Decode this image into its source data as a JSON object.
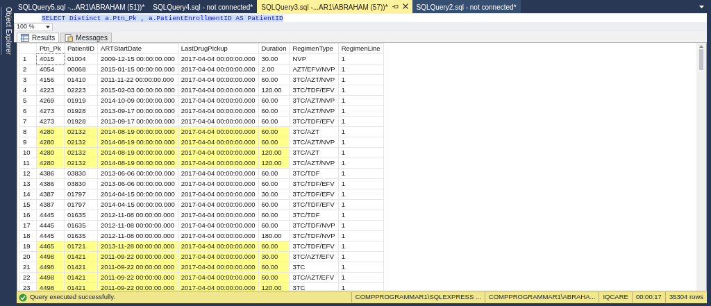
{
  "side_panel": {
    "title": "Object Explorer"
  },
  "doc_tabs": [
    {
      "label": "SQLQuery5.sql -...AR1\\ABRAHAM (51))*",
      "selected": false
    },
    {
      "label": "SQLQuery4.sql - not connected*",
      "selected": false
    },
    {
      "label": "SQLQuery3.sql -...AR1\\ABRAHAM (57))*",
      "selected": true
    },
    {
      "label": "SQLQuery2.sql - not connected*",
      "selected": false
    }
  ],
  "editor": {
    "code": "SELECT Distinct a.Ptn_Pk , a.PatientEnrollmentID AS PatientID"
  },
  "zoom": {
    "value": "100 %"
  },
  "result_tabs": [
    {
      "label": "Results",
      "selected": true
    },
    {
      "label": "Messages",
      "selected": false
    }
  ],
  "table": {
    "columns": [
      "Ptn_Pk",
      "PatientID",
      "ARTStartDate",
      "LastDrugPickup",
      "Duration",
      "RegimenType",
      "RegimenLine"
    ],
    "rows": [
      {
        "num": "1",
        "cells": [
          "4015",
          "01004",
          "2009-12-15 00:00:00.000",
          "2017-04-04 00:00:00.000",
          "30.00",
          "NVP",
          "1"
        ],
        "highlighted": false
      },
      {
        "num": "2",
        "cells": [
          "4054",
          "00068",
          "2015-01-15 00:00:00.000",
          "2017-04-04 00:00:00.000",
          "2.00",
          "AZT/EFV/NVP",
          "1"
        ],
        "highlighted": false
      },
      {
        "num": "3",
        "cells": [
          "4156",
          "01410",
          "2011-11-22 00:00:00.000",
          "2017-04-04 00:00:00.000",
          "60.00",
          "3TC/AZT/NVP",
          "1"
        ],
        "highlighted": false
      },
      {
        "num": "4",
        "cells": [
          "4223",
          "02223",
          "2015-02-03 00:00:00.000",
          "2017-04-04 00:00:00.000",
          "120.00",
          "3TC/TDF/EFV",
          "1"
        ],
        "highlighted": false
      },
      {
        "num": "5",
        "cells": [
          "4269",
          "01919",
          "2014-10-09 00:00:00.000",
          "2017-04-04 00:00:00.000",
          "60.00",
          "3TC/AZT/NVP",
          "1"
        ],
        "highlighted": false
      },
      {
        "num": "6",
        "cells": [
          "4273",
          "01928",
          "2013-09-17 00:00:00.000",
          "2017-04-04 00:00:00.000",
          "60.00",
          "3TC/AZT/NVP",
          "1"
        ],
        "highlighted": false
      },
      {
        "num": "7",
        "cells": [
          "4273",
          "01928",
          "2013-09-17 00:00:00.000",
          "2017-04-04 00:00:00.000",
          "60.00",
          "3TC/TDF/EFV",
          "1"
        ],
        "highlighted": false
      },
      {
        "num": "8",
        "cells": [
          "4280",
          "02132",
          "2014-08-19 00:00:00.000",
          "2017-04-04 00:00:00.000",
          "60.00",
          "3TC/AZT",
          "1"
        ],
        "highlighted": true
      },
      {
        "num": "9",
        "cells": [
          "4280",
          "02132",
          "2014-08-19 00:00:00.000",
          "2017-04-04 00:00:00.000",
          "60.00",
          "3TC/AZT/NVP",
          "1"
        ],
        "highlighted": true
      },
      {
        "num": "10",
        "cells": [
          "4280",
          "02132",
          "2014-08-19 00:00:00.000",
          "2017-04-04 00:00:00.000",
          "120.00",
          "3TC/AZT",
          "1"
        ],
        "highlighted": true
      },
      {
        "num": "11",
        "cells": [
          "4280",
          "02132",
          "2014-08-19 00:00:00.000",
          "2017-04-04 00:00:00.000",
          "120.00",
          "3TC/AZT/NVP",
          "1"
        ],
        "highlighted": true
      },
      {
        "num": "12",
        "cells": [
          "4386",
          "03830",
          "2013-06-06 00:00:00.000",
          "2017-04-04 00:00:00.000",
          "60.00",
          "3TC/TDF",
          "1"
        ],
        "highlighted": false
      },
      {
        "num": "13",
        "cells": [
          "4386",
          "03830",
          "2013-06-06 00:00:00.000",
          "2017-04-04 00:00:00.000",
          "60.00",
          "3TC/TDF/EFV",
          "1"
        ],
        "highlighted": false
      },
      {
        "num": "14",
        "cells": [
          "4387",
          "01797",
          "2014-04-15 00:00:00.000",
          "2017-04-04 00:00:00.000",
          "30.00",
          "3TC/TDF/EFV",
          "1"
        ],
        "highlighted": false
      },
      {
        "num": "15",
        "cells": [
          "4387",
          "01797",
          "2014-04-15 00:00:00.000",
          "2017-04-04 00:00:00.000",
          "60.00",
          "3TC/TDF/EFV",
          "1"
        ],
        "highlighted": false
      },
      {
        "num": "16",
        "cells": [
          "4445",
          "01635",
          "2012-11-08 00:00:00.000",
          "2017-04-04 00:00:00.000",
          "60.00",
          "3TC/TDF",
          "1"
        ],
        "highlighted": false
      },
      {
        "num": "17",
        "cells": [
          "4445",
          "01635",
          "2012-11-08 00:00:00.000",
          "2017-04-04 00:00:00.000",
          "60.00",
          "3TC/TDF/NVP",
          "1"
        ],
        "highlighted": false
      },
      {
        "num": "18",
        "cells": [
          "4445",
          "01635",
          "2012-11-08 00:00:00.000",
          "2017-04-04 00:00:00.000",
          "180.00",
          "3TC/TDF/NVP",
          "1"
        ],
        "highlighted": false
      },
      {
        "num": "19",
        "cells": [
          "4465",
          "01721",
          "2013-11-28 00:00:00.000",
          "2017-04-04 00:00:00.000",
          "60.00",
          "3TC/TDF/EFV",
          "1"
        ],
        "highlighted": true
      },
      {
        "num": "20",
        "cells": [
          "4498",
          "01421",
          "2011-09-22 00:00:00.000",
          "2017-04-04 00:00:00.000",
          "30.00",
          "3TC/AZT/EFV",
          "1"
        ],
        "highlighted": true
      },
      {
        "num": "21",
        "cells": [
          "4498",
          "01421",
          "2011-09-22 00:00:00.000",
          "2017-04-04 00:00:00.000",
          "60.00",
          "3TC",
          "1"
        ],
        "highlighted": true
      },
      {
        "num": "22",
        "cells": [
          "4498",
          "01421",
          "2011-09-22 00:00:00.000",
          "2017-04-04 00:00:00.000",
          "60.00",
          "3TC/AZT/EFV",
          "1"
        ],
        "highlighted": true
      },
      {
        "num": "23",
        "cells": [
          "4498",
          "01421",
          "2011-09-22 00:00:00.000",
          "2017-04-04 00:00:00.000",
          "120.00",
          "3TC",
          "1"
        ],
        "highlighted": true
      }
    ]
  },
  "status_bar": {
    "message": "Query executed successfully.",
    "server": "COMPPROGRAMMAR1\\SQLEXPRESS ...",
    "user": "COMPPROGRAMMAR1\\ABRAHA...",
    "database": "IQCARE",
    "elapsed": "00:00:17",
    "rows": "35304 rows"
  }
}
